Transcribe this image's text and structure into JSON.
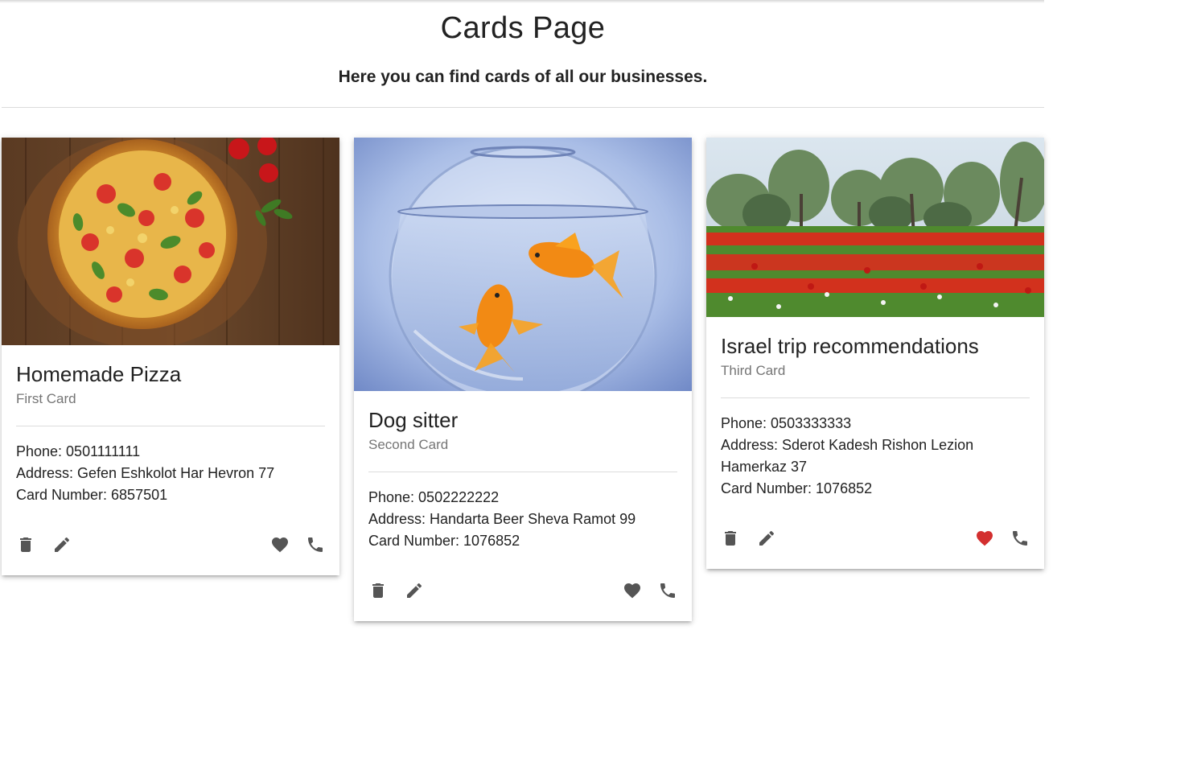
{
  "header": {
    "title": "Cards Page",
    "subtitle": "Here you can find cards of all our businesses."
  },
  "colors": {
    "icon": "#555555",
    "favorite_active": "#d32f2f",
    "divider": "#dcdcdc",
    "subtitle_text": "#757575"
  },
  "cards": [
    {
      "title": "Homemade Pizza",
      "subtitle": "First Card",
      "image": "pizza-photo",
      "phone": "Phone: 0501111111",
      "address": "Address: Gefen Eshkolot Har Hevron 77",
      "card_number": "Card Number: 6857501",
      "favorite": false,
      "icons": [
        "delete-icon",
        "edit-icon",
        "favorite-icon",
        "phone-icon"
      ]
    },
    {
      "title": "Dog sitter",
      "subtitle": "Second Card",
      "image": "goldfish-bowl-photo",
      "phone": "Phone: 0502222222",
      "address": "Address: Handarta Beer Sheva Ramot 99",
      "card_number": "Card Number: 1076852",
      "favorite": false,
      "icons": [
        "delete-icon",
        "edit-icon",
        "favorite-icon",
        "phone-icon"
      ]
    },
    {
      "title": "Israel trip recommendations",
      "subtitle": "Third Card",
      "image": "red-flower-field-photo",
      "phone": "Phone: 0503333333",
      "address": "Address: Sderot Kadesh Rishon Lezion Hamerkaz 37",
      "card_number": "Card Number: 1076852",
      "favorite": true,
      "icons": [
        "delete-icon",
        "edit-icon",
        "favorite-icon",
        "phone-icon"
      ]
    }
  ]
}
